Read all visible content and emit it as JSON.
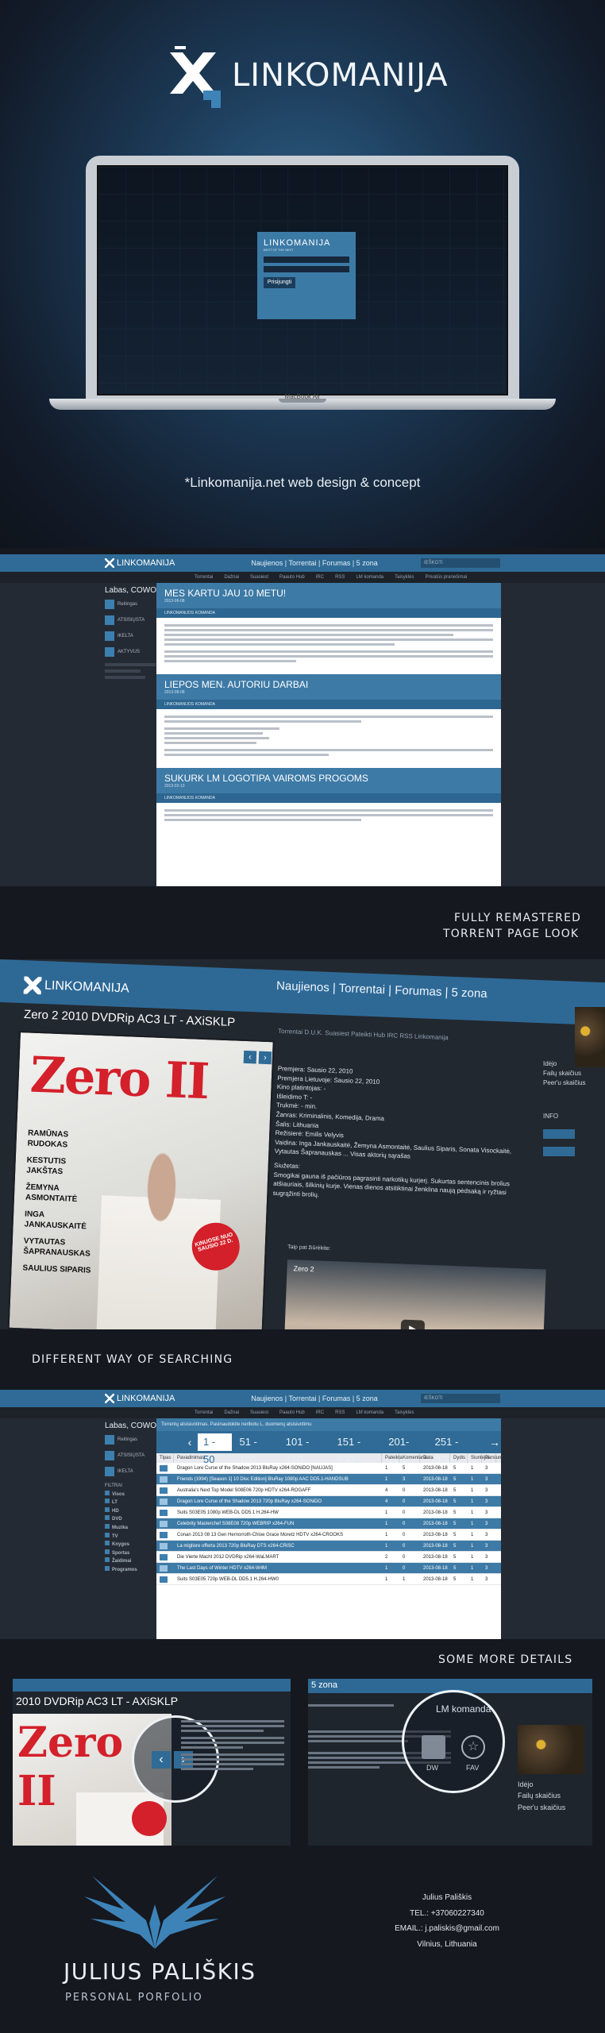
{
  "hero": {
    "brand": "LINKOMANIJA",
    "login": {
      "title": "LINKOMANIJA",
      "subtitle": "BEST OF THE BEST",
      "button": "Prisijungti"
    },
    "laptop_label": "MacBook Air",
    "caption": "*Linkomanija.net web design & concept"
  },
  "site": {
    "brand": "LINKOMANIJA",
    "nav": "Naujienos | Torrentai | Forumas | 5 zona",
    "search_placeholder": "IEŠKOTI",
    "subnav": [
      "Torrentai",
      "Dažnai",
      "Suasiest",
      "Paauto Hub",
      "IRC",
      "RSS",
      "LM komanda",
      "Taisyklės",
      "Privatūs pranešimai"
    ],
    "greeting": "Labas, COWON !",
    "sidebar_items": [
      "Reitingas",
      "ATSISIŲSTA",
      "IKELTA",
      "AKTYVUS"
    ]
  },
  "news": {
    "items": [
      {
        "title": "MES KARTU JAU 10 METU!",
        "date": "2013-06-08",
        "tag": "LINKOMANIJOS KOMANDA"
      },
      {
        "title": "LIEPOS MEN. AUTORIU DARBAI",
        "date": "2013-08-08",
        "tag": "LINKOMANIJOS KOMANDA"
      },
      {
        "title": "SUKURK LM LOGOTIPA  VAIROMS PROGOMS",
        "date": "2013-02-13",
        "tag": "LINKOMANIJOS KOMANDA"
      }
    ]
  },
  "captions": {
    "torrent_page": [
      "FULLY REMASTERED",
      "TORRENT PAGE LOOK"
    ],
    "searching": "DIFFERENT WAY OF SEARCHING",
    "details": "SOME MORE DETAILS"
  },
  "torrent": {
    "nav": "Naujienos | Torrentai | Forumas | 5 zona",
    "title": "Zero 2 2010 DVDRip AC3 LT - AXiSKLP",
    "tabs": "Torrentai   D.U.K.   Suasiest   Pateikti Hub   IRC   RSS   Linkomanija",
    "poster": {
      "title": "Zero II",
      "names": [
        "RAMŪNAS RUDOKAS",
        "KESTUTIS JAKŠTAS",
        "ŽEMYNA ASMONTAITĖ",
        "INGA JANKAUSKAITĖ",
        "VYTAUTAS ŠAPRANAUSKAS",
        "SAULIUS SIPARIS"
      ],
      "badge": "KINUOSE NUO SAUSIO 22 D."
    },
    "info": [
      "Premjera: Sausio 22, 2010",
      "Premjera Lietuvoje: Sausio 22, 2010",
      "Kino platintojas: -",
      "Išleidimo T: -",
      "Trukmė: - min.",
      "Žanras: Kriminalinis, Komedija, Drama",
      "Šalis: Lithuania",
      "Režisierė: Emilis Velyvis",
      "Vaidina: Inga Jankauskaitė, Žemyna Asmontaitė, Saulius Siparis, Sonata Visockaitė, Vytautas Šapranauskas ... Visas aktorių sąrašas",
      "Siužetas:",
      "Smogikai gauna iš pačiūros pagrasinti narkotikų kurjerį. Sukurtas sentencinis brolius atšiauriais, šilkinių kurje. Vienas dienos atsitiktinai ženklina naują pėdsaką ir ryžtasi sugrąžinti brolių."
    ],
    "trailer_caption": "Taip pat žiūrėkite:",
    "video_title": "Zero 2",
    "right": {
      "idejo": "Idėjo",
      "failu": "Failų skaičius",
      "peers": "Peer'u skaičius",
      "info": "INFO"
    }
  },
  "search": {
    "bar_text": "Torrentų atsisiuntimas. Pasinaudokite neribotu L. duomenų atsisiuntimu",
    "pages": [
      "1 - 50",
      "51 - 100",
      "101 - 150",
      "151 - 200",
      "201-250",
      "251 - 300..."
    ],
    "columns": [
      "Tipas",
      "Pavadinimas",
      "Pateikta",
      "Komentarai",
      "Data",
      "Dydis",
      "Siuntėjai",
      "Parsiunt."
    ],
    "rows": [
      {
        "name": "Dragon Lore Curse of the Shadow 2013 BluRay x264-SONiDO [NAUJAS]",
        "pr": "1",
        "kom": "5",
        "date": "2013-08-18",
        "size": "5",
        "seed": "1",
        "peer": "3",
        "hl": false
      },
      {
        "name": "Friends (1994) [Season 1] 10 Disc Edition] BluRay 1080p AAC DD5.1-HANDSUB",
        "pr": "1",
        "kom": "3",
        "date": "2013-08-18",
        "size": "5",
        "seed": "1",
        "peer": "3",
        "hl": true
      },
      {
        "name": "Australia's Next Top Model S08E06 720p HDTV x264-ROGAFF",
        "pr": "4",
        "kom": "0",
        "date": "2013-08-18",
        "size": "5",
        "seed": "1",
        "peer": "3",
        "hl": false
      },
      {
        "name": "Dragon Lore Curse of the Shadow 2013 720p BluRay x264-SONiDO",
        "pr": "4",
        "kom": "0",
        "date": "2013-08-18",
        "size": "5",
        "seed": "1",
        "peer": "3",
        "hl": true
      },
      {
        "name": "Suits S03E05 1080p WEB-DL DD5.1 H.264-HW",
        "pr": "1",
        "kom": "0",
        "date": "2013-08-18",
        "size": "5",
        "seed": "1",
        "peer": "3",
        "hl": false
      },
      {
        "name": "Celebrity Masterchef S08E08 720p WEBRIP x264-FUN",
        "pr": "1",
        "kom": "0",
        "date": "2013-08-18",
        "size": "5",
        "seed": "1",
        "peer": "3",
        "hl": true
      },
      {
        "name": "Conan 2013 08 13 Gen Hernorroth-Chloe Grace Moretz HDTV x264-CROOKS",
        "pr": "1",
        "kom": "0",
        "date": "2013-08-18",
        "size": "5",
        "seed": "1",
        "peer": "3",
        "hl": false
      },
      {
        "name": "La migliore offerta 2013 720p BluRay DTS x264-CRiSC",
        "pr": "1",
        "kom": "0",
        "date": "2013-08-18",
        "size": "5",
        "seed": "1",
        "peer": "3",
        "hl": true
      },
      {
        "name": "Die Vierte Macht 2012 DVDRip x264-WaLMART",
        "pr": "2",
        "kom": "0",
        "date": "2013-08-18",
        "size": "5",
        "seed": "1",
        "peer": "3",
        "hl": false
      },
      {
        "name": "The Last Days of Winter HDTV x264-W4M",
        "pr": "1",
        "kom": "0",
        "date": "2013-08-18",
        "size": "5",
        "seed": "1",
        "peer": "3",
        "hl": true
      },
      {
        "name": "Suits S03E05 720p WEB-DL DD5.1 H.264-HW0",
        "pr": "1",
        "kom": "1",
        "date": "2013-08-18",
        "size": "5",
        "seed": "1",
        "peer": "3",
        "hl": false
      }
    ],
    "tree_title": "FILTRAI",
    "tree": [
      "Visos",
      "LT",
      "HD",
      "DVD",
      "Muzika",
      "TV",
      "Knygos",
      "Sportas",
      "Žaidimai",
      "Programos"
    ]
  },
  "details": {
    "left_title": "2010 DVDRip AC3 LT - AXiSKLP",
    "right_tab": "5 zona",
    "right_label": "LM komanda",
    "dl_label": "DW",
    "fav_label": "FAV",
    "idejo": "Idėjo",
    "failu": "Failų skaičius",
    "peers": "Peer'u skaičius"
  },
  "footer": {
    "name": "JULIUS PALIŠKIS",
    "subtitle": "PERSONAL PORFOLIO",
    "contact_name": "Julius Pališkis",
    "tel": "TEL.: +37060227340",
    "email": "EMAIL.: j.paliskis@gmail.com",
    "city": "Vilnius, Lithuania"
  },
  "colors": {
    "accent": "#2f6b96",
    "dark": "#15181f",
    "brand_red": "#d3202a"
  }
}
